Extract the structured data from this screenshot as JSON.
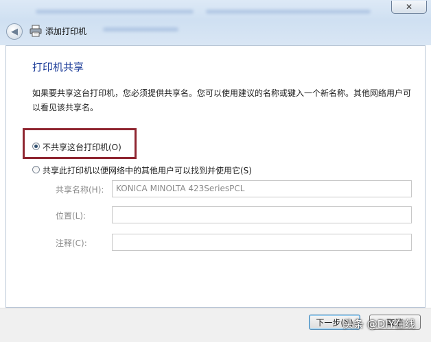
{
  "window": {
    "title": "添加打印机",
    "close_symbol": "✕"
  },
  "icons": {
    "back": "back-arrow-icon",
    "printer": "printer-icon",
    "close": "close-icon"
  },
  "page": {
    "heading": "打印机共享",
    "description": "如果要共享这台打印机，您必须提供共享名。您可以使用建议的名称或键入一个新名称。其他网络用户可以看见该共享名。"
  },
  "options": [
    {
      "label": "不共享这台打印机(O)",
      "selected": true
    },
    {
      "label": "共享此打印机以便网络中的其他用户可以找到并使用它(S)",
      "selected": false
    }
  ],
  "fields": {
    "share_name": {
      "label": "共享名称(H):",
      "value": "KONICA MINOLTA 423SeriesPCL"
    },
    "location": {
      "label": "位置(L):",
      "value": ""
    },
    "comment": {
      "label": "注释(C):",
      "value": ""
    }
  },
  "buttons": {
    "next": "下一步(N)",
    "cancel": "取消"
  },
  "watermark": "头条 @DIY在线",
  "colors": {
    "heading": "#1f3f9a",
    "highlight": "#8f2530",
    "glass": "#cfe0f2"
  }
}
